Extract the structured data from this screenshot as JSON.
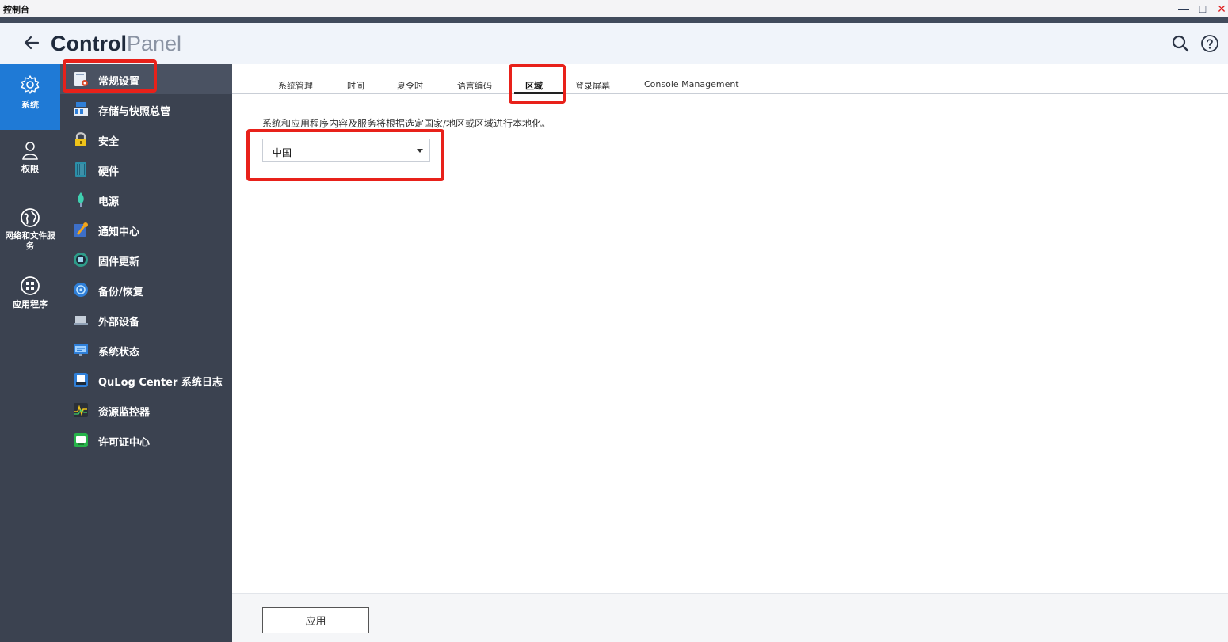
{
  "window": {
    "title": "控制台",
    "minimize_label": "—",
    "maximize_label": "□",
    "close_label": "✕"
  },
  "header": {
    "title_bold": "Control",
    "title_light": "Panel"
  },
  "rail": [
    {
      "label": "系统",
      "icon": "gear-icon",
      "active": true
    },
    {
      "label": "权限",
      "icon": "user-icon",
      "active": false
    },
    {
      "label": "网络和文件服务",
      "icon": "globe-icon",
      "active": false
    },
    {
      "label": "应用程序",
      "icon": "apps-icon",
      "active": false
    }
  ],
  "submenu": [
    {
      "label": "常规设置",
      "icon": "general-settings-icon",
      "active": true
    },
    {
      "label": "存储与快照总管",
      "icon": "storage-icon"
    },
    {
      "label": "安全",
      "icon": "security-icon"
    },
    {
      "label": "硬件",
      "icon": "hardware-icon"
    },
    {
      "label": "电源",
      "icon": "power-icon"
    },
    {
      "label": "通知中心",
      "icon": "notification-icon"
    },
    {
      "label": "固件更新",
      "icon": "firmware-update-icon"
    },
    {
      "label": "备份/恢复",
      "icon": "backup-restore-icon"
    },
    {
      "label": "外部设备",
      "icon": "external-device-icon"
    },
    {
      "label": "系统状态",
      "icon": "system-status-icon"
    },
    {
      "label": "QuLog Center 系统日志",
      "icon": "qulog-icon"
    },
    {
      "label": "资源监控器",
      "icon": "resource-monitor-icon"
    },
    {
      "label": "许可证中心",
      "icon": "license-center-icon"
    }
  ],
  "tabs": [
    {
      "label": "系统管理"
    },
    {
      "label": "时间"
    },
    {
      "label": "夏令时"
    },
    {
      "label": "语言编码"
    },
    {
      "label": "区域",
      "active": true
    },
    {
      "label": "登录屏幕"
    },
    {
      "label": "Console Management"
    }
  ],
  "region": {
    "description": "系统和应用程序内容及服务将根据选定国家/地区或区域进行本地化。",
    "selected": "中国"
  },
  "footer": {
    "apply_label": "应用"
  },
  "colors": {
    "rail_bg": "#3b4250",
    "rail_active": "#1f7ad6",
    "highlight": "#e8211a",
    "header_bg": "#f0f4fa"
  }
}
